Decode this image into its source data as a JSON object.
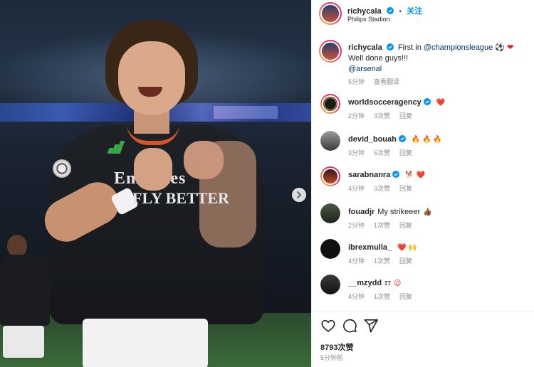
{
  "post": {
    "author": "richycala",
    "follow_label": "关注",
    "location": "Philips Stadion",
    "likes": "8793次赞",
    "time": "5分钟前"
  },
  "caption": {
    "username": "richycala",
    "text_prefix": "First in ",
    "mention_1": "@championsleague",
    "line_2": "Well done guys!!!",
    "mention_2": "@arsenal",
    "time": "5分钟",
    "translate": "查看翻译"
  },
  "comments": [
    {
      "username": "worldsocceragency",
      "verified": true,
      "text": "",
      "emoji": "❤️",
      "time": "2分钟",
      "likes": "3次赞",
      "reply": "回复"
    },
    {
      "username": "devid_bouah",
      "verified": true,
      "text": "",
      "emoji": "🔥 🔥 🔥",
      "time": "3分钟",
      "likes": "6次赞",
      "reply": "回复"
    },
    {
      "username": "sarabnanra",
      "verified": true,
      "text": "",
      "emoji": "🐕 ❤️",
      "time": "4分钟",
      "likes": "3次赞",
      "reply": "回复"
    },
    {
      "username": "fouadjr",
      "verified": false,
      "text": "My strikeeer",
      "emoji": "👍🏾",
      "time": "2分钟",
      "likes": "1次赞",
      "reply": "回复"
    },
    {
      "username": "ibrexmulla_",
      "verified": false,
      "text": "",
      "emoji": "❤️ 🙌",
      "time": "4分钟",
      "likes": "1次赞",
      "reply": "回复"
    },
    {
      "username": "__mzydd",
      "verified": false,
      "text": "ɪᴛ",
      "emoji": "😉",
      "time": "4分钟",
      "likes": "1次赞",
      "reply": "回复"
    }
  ],
  "photo": {
    "sponsor_line_1": "Emirates",
    "sponsor_line_2": "FLY BETTER"
  },
  "icons": {
    "verified": "verified-badge-icon",
    "like": "heart-icon",
    "comment": "comment-icon",
    "share": "paper-plane-icon",
    "next": "chevron-right-icon"
  },
  "colors": {
    "verified_blue": "#0095f6",
    "follow_blue": "#0095f6",
    "heart_red": "#ed1c24"
  }
}
